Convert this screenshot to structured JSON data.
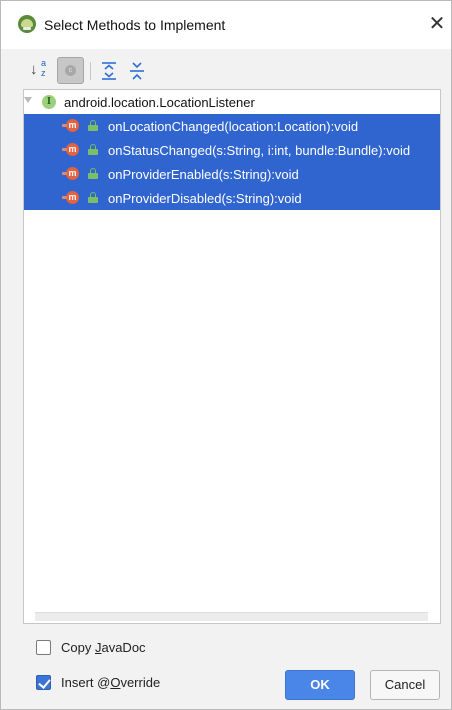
{
  "window": {
    "title": "Select Methods to Implement",
    "close_glyph": "✕",
    "app_icon": "android-studio-icon"
  },
  "toolbar": {
    "sort_alpha": {
      "icon": "sort-alphabetically-icon",
      "glyph_arrow": "↓",
      "glyph_a": "a",
      "glyph_z": "z"
    },
    "show_classes": {
      "icon": "show-classes-icon",
      "glyph": "c",
      "active": true
    },
    "expand_all": {
      "icon": "expand-all-icon"
    },
    "collapse_all": {
      "icon": "collapse-all-icon"
    }
  },
  "tree": {
    "root": {
      "label": "android.location.LocationListener",
      "icon": "interface-icon",
      "icon_glyph": "I"
    },
    "methods": [
      {
        "label": "onLocationChanged(location:Location):void",
        "selected": true
      },
      {
        "label": "onStatusChanged(s:String, i:int, bundle:Bundle):void",
        "selected": true
      },
      {
        "label": "onProviderEnabled(s:String):void",
        "selected": true
      },
      {
        "label": "onProviderDisabled(s:String):void",
        "selected": true
      }
    ],
    "method_icon_glyph": "m"
  },
  "options": {
    "copy_javadoc": {
      "prefix": "Copy ",
      "mnemonic": "J",
      "suffix": "avaDoc",
      "checked": false
    },
    "insert_override": {
      "prefix": "Insert @",
      "mnemonic": "O",
      "suffix": "verride",
      "checked": true
    }
  },
  "buttons": {
    "ok": "OK",
    "cancel": "Cancel"
  },
  "colors": {
    "selection": "#3064cf",
    "primary_button": "#4a86e8",
    "checkbox_checked": "#3b73d6"
  }
}
